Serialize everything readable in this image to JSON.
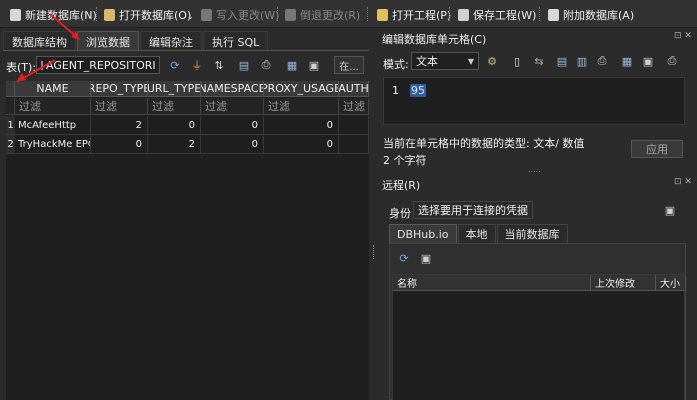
{
  "toolbar": {
    "new_db": "新建数据库(N)",
    "open_db": "打开数据库(O)",
    "write_changes": "写入更改(W)",
    "revert_changes": "倒退更改(R)",
    "open_project": "打开工程(P)",
    "save_project": "保存工程(W)",
    "attach_db": "附加数据库(A)"
  },
  "left_tabs": [
    "数据库结构",
    "浏览数据",
    "编辑杂注",
    "执行 SQL"
  ],
  "browse": {
    "table_label": "表(T):",
    "table_value": "AGENT_REPOSITORI",
    "more_button": "在...",
    "columns": [
      "NAME",
      "REPO_TYPE",
      "URL_TYPE",
      "NAMESPACE",
      "PROXY_USAGE",
      "AUTH"
    ],
    "filter_placeholder": "过滤",
    "rows": [
      {
        "num": "1",
        "cells": [
          "McAfeeHttp",
          "2",
          "0",
          "0",
          "0",
          ""
        ]
      },
      {
        "num": "2",
        "cells": [
          "TryHackMe EPO",
          "0",
          "2",
          "0",
          "0",
          ""
        ]
      }
    ]
  },
  "cell_editor": {
    "title": "编辑数据库单元格(C)",
    "mode_label": "模式:",
    "mode_value": "文本",
    "line_number": "1",
    "value": "95",
    "type_info": "当前在单元格中的数据的类型: 文本/ 数值",
    "char_count": "2 个字符",
    "apply_button": "应用",
    "handle": "....."
  },
  "remote": {
    "title": "远程(R)",
    "identity_label": "身份",
    "identity_value": "选择要用于连接的凭据",
    "tabs": [
      "DBHub.io",
      "本地",
      "当前数据库"
    ],
    "columns": [
      "名称",
      "上次修改",
      "大小"
    ]
  },
  "dock_controls": "⊡ ✕",
  "colors": {
    "accent": "#2f5f9e",
    "annotation_arrow": "#e02020"
  }
}
